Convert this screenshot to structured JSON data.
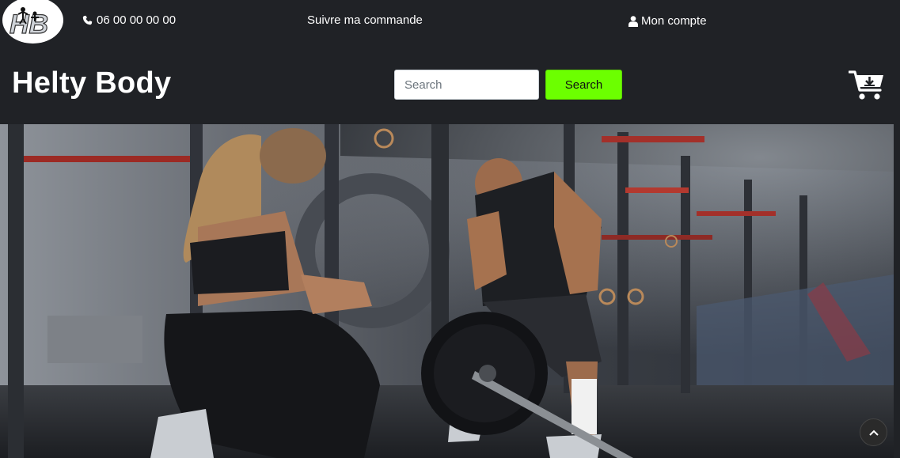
{
  "header": {
    "phone_icon": "phone-icon",
    "phone": "06 00 00 00 00",
    "track_order": "Suivre ma commande",
    "account_icon": "user-icon",
    "account": "Mon compte"
  },
  "brand": {
    "logo": "helty-body-logo",
    "name": "Helty Body"
  },
  "search": {
    "placeholder": "Search",
    "value": "",
    "button_label": "Search"
  },
  "cart": {
    "icon": "cart-download-icon"
  },
  "hero": {
    "image": "gym-couple-deadlift-photo"
  },
  "scroll_top": {
    "icon": "chevron-up-icon"
  },
  "colors": {
    "background": "#202226",
    "search_button": "#6cff00",
    "text": "#ffffff"
  }
}
